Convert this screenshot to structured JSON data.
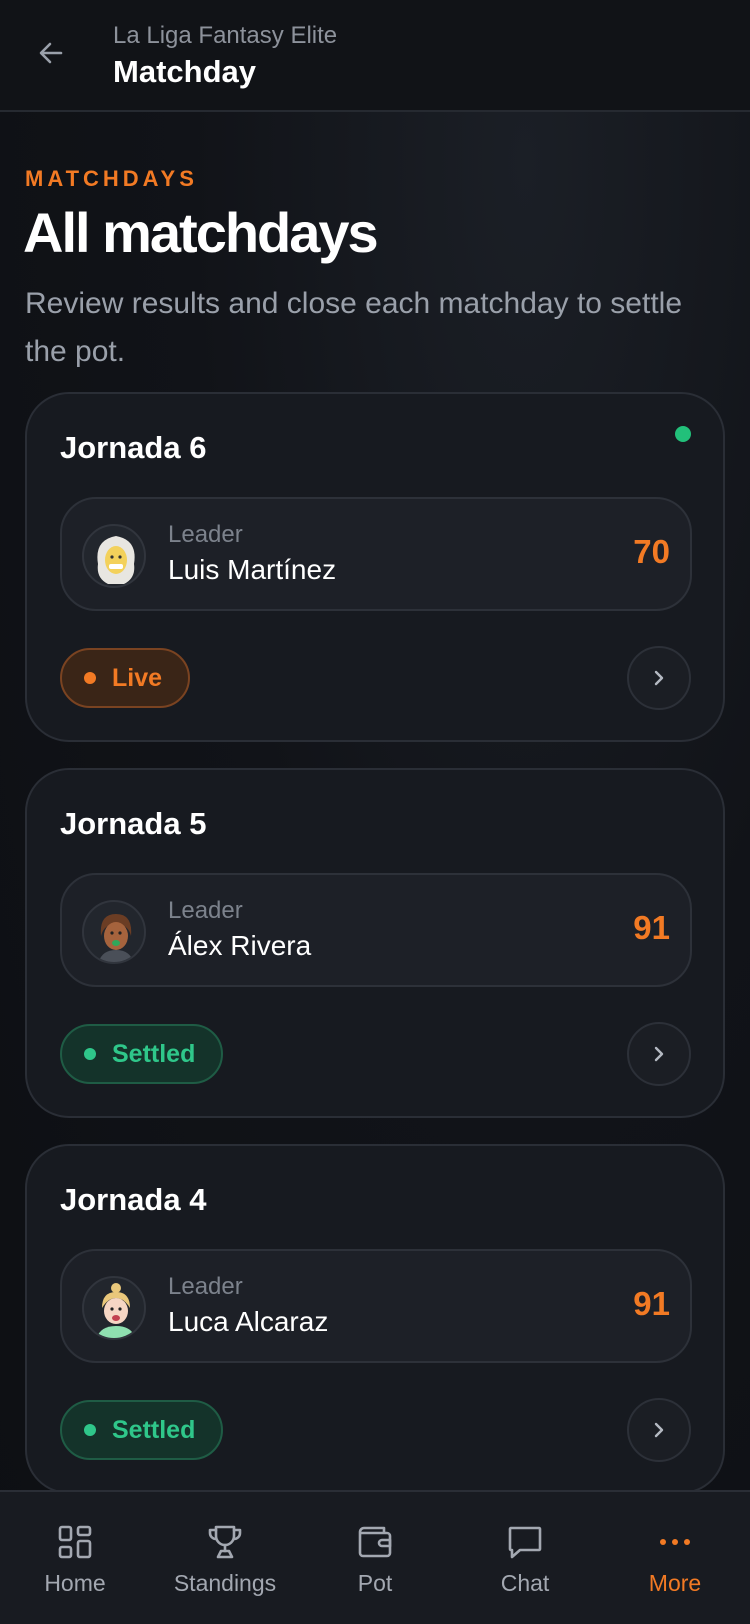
{
  "header": {
    "subtitle": "La Liga Fantasy Elite",
    "title": "Matchday"
  },
  "intro": {
    "eyebrow": "MATCHDAYS",
    "title": "All matchdays",
    "description": "Review results and close each matchday to settle the pot."
  },
  "matchdays": [
    {
      "title": "Jornada 6",
      "leader_label": "Leader",
      "leader_name": "Luis Martínez",
      "score": "70",
      "status": "Live",
      "live_indicator": true
    },
    {
      "title": "Jornada 5",
      "leader_label": "Leader",
      "leader_name": "Álex Rivera",
      "score": "91",
      "status": "Settled"
    },
    {
      "title": "Jornada 4",
      "leader_label": "Leader",
      "leader_name": "Luca Alcaraz",
      "score": "91",
      "status": "Settled"
    }
  ],
  "nav": {
    "items": [
      {
        "label": "Home",
        "icon": "grid-icon"
      },
      {
        "label": "Standings",
        "icon": "trophy-icon"
      },
      {
        "label": "Pot",
        "icon": "wallet-icon"
      },
      {
        "label": "Chat",
        "icon": "chat-bubble-icon"
      },
      {
        "label": "More",
        "icon": "more-dots-icon",
        "active": true
      }
    ]
  },
  "colors": {
    "accent": "#f27a24",
    "settled": "#2fc78a",
    "background": "#0f1115",
    "card": "#171a20"
  }
}
